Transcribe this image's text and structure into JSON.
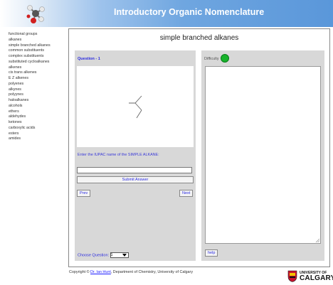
{
  "app": {
    "title": "Introductory Organic Nomenclature"
  },
  "sidebar": {
    "items": [
      {
        "label": "functional groups"
      },
      {
        "label": "alkanes"
      },
      {
        "label": "simple branched alkanes"
      },
      {
        "label": "common substituents"
      },
      {
        "label": "complex substituents"
      },
      {
        "label": "substituted cycloalkanes"
      },
      {
        "label": "alkenes"
      },
      {
        "label": "cis trans alkenes"
      },
      {
        "label": "E Z alkenes"
      },
      {
        "label": "polyenes"
      },
      {
        "label": "alkynes"
      },
      {
        "label": "polyynes"
      },
      {
        "label": "haloalkanes"
      },
      {
        "label": "alcohols"
      },
      {
        "label": "ethers"
      },
      {
        "label": "aldehydes"
      },
      {
        "label": "ketones"
      },
      {
        "label": "carboxylic acids"
      },
      {
        "label": "esters"
      },
      {
        "label": "amides"
      }
    ]
  },
  "main": {
    "title": "simple branched alkanes",
    "question": {
      "label": "Question - 1",
      "prompt": "Enter the IUPAC name of the SIMPLE ALKANE:",
      "answer_value": "",
      "submit_label": "Submit Answer",
      "prev_label": "Prev",
      "next_label": "Next",
      "choose_label": "Choose Question:",
      "choose_value": "1"
    },
    "right": {
      "difficulty_label": "Difficulty",
      "difficulty_color": "#17b32b",
      "feedback_text": "",
      "help_label": "help"
    }
  },
  "footer": {
    "prefix": "Copyright © ",
    "author": "Dr. Ian Hunt",
    "suffix": ", Department of Chemistry, University of Calgary"
  },
  "university": {
    "line1": "UNIVERSITY OF",
    "line2": "CALGARY"
  }
}
